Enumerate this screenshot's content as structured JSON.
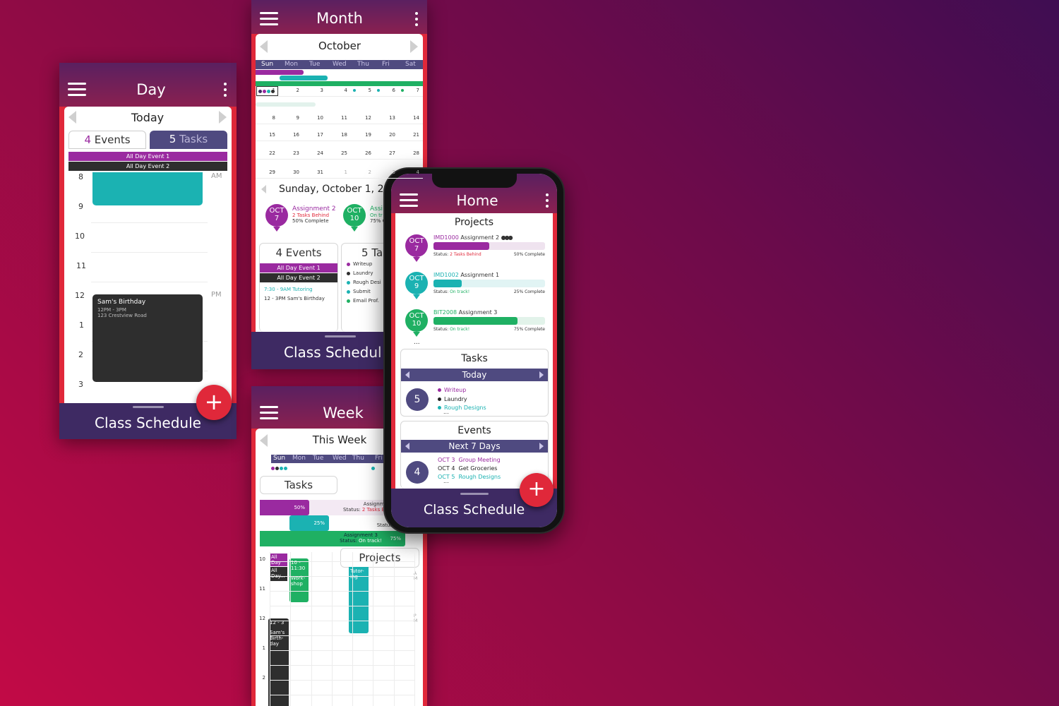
{
  "colors": {
    "purple": "#9a2aa0",
    "teal": "#1bb2b2",
    "green": "#1fb063",
    "navy": "#3e2a63",
    "red": "#e0283a",
    "dark": "#2e2e2e"
  },
  "day": {
    "title": "Day",
    "date_label": "Today",
    "events_tab": {
      "count": "4",
      "label": "Events"
    },
    "tasks_tab": {
      "count": "5",
      "label": "Tasks"
    },
    "all_day": [
      "All Day Event 1",
      "All Day Event 2"
    ],
    "hours": [
      "8",
      "9",
      "10",
      "11",
      "12",
      "1",
      "2",
      "3"
    ],
    "am": "AM",
    "pm": "PM",
    "birthday": {
      "title": "Sam's Birthday",
      "time": "12PM - 3PM",
      "place": "123 Crestview Road"
    },
    "footer": "Class Schedule",
    "fab": "+"
  },
  "month": {
    "title": "Month",
    "month_label": "October",
    "weekdays": [
      "Sun",
      "Mon",
      "Tue",
      "Wed",
      "Thu",
      "Fri",
      "Sat"
    ],
    "weeks": [
      [
        "1",
        "2",
        "3",
        "4",
        "5",
        "6",
        "7"
      ],
      [
        "8",
        "9",
        "10",
        "11",
        "12",
        "13",
        "14"
      ],
      [
        "15",
        "16",
        "17",
        "18",
        "19",
        "20",
        "21"
      ],
      [
        "22",
        "23",
        "24",
        "25",
        "26",
        "27",
        "28"
      ],
      [
        "29",
        "30",
        "31",
        "1",
        "2",
        "3",
        "4"
      ]
    ],
    "selected_date": "Sunday, October 1, 20",
    "projects": [
      {
        "month": "OCT",
        "day": "7",
        "name": "Assignment 2",
        "status": "2 Tasks Behind",
        "progress": "50% Complete"
      },
      {
        "month": "OCT",
        "day": "10",
        "name": "Assi",
        "status": "On tr",
        "progress": "75% C"
      }
    ],
    "events_panel": {
      "count": "4",
      "label": "Events",
      "all_day": [
        "All Day Event 1",
        "All Day Event 2"
      ],
      "item1_time": "7:30 - 9AM",
      "item1_name": "Tutoring",
      "item2_time": "12 - 3PM",
      "item2_name": "Sam's Birthday"
    },
    "tasks_panel": {
      "count": "5",
      "label": "Tas",
      "items": [
        "Writeup",
        "Laundry",
        "Rough Desi",
        "Submit",
        "Email Prof."
      ]
    },
    "footer": "Class Schedul"
  },
  "week": {
    "title": "Week",
    "week_label": "This Week",
    "weekdays": [
      "Sun",
      "Mon",
      "Tue",
      "Wed",
      "Thu",
      "Fri"
    ],
    "tasks_label": "Tasks",
    "projects_label": "Projects",
    "bars": [
      {
        "label": "50%",
        "name": "Assignment",
        "status_prefix": "Status: ",
        "status": "2 Tasks Behi"
      },
      {
        "label": "25%",
        "name": "A",
        "status_prefix": "Status",
        "status": ""
      },
      {
        "label": "75%",
        "name": "Assignment 3",
        "status_prefix": "Status: ",
        "status": "On track!"
      }
    ],
    "hours": [
      "10",
      "11",
      "12",
      "1",
      "2"
    ],
    "blocks": {
      "allday1": "All Day",
      "allday2": "All Day...",
      "workshop_time": "10 - 11:30",
      "workshop": "Work-shop",
      "tutoring": "Tutor-ing",
      "birthday_time": "12 - 3",
      "birthday": "Sam's Birth-day"
    },
    "am": "AM",
    "pm": "PM"
  },
  "home": {
    "title": "Home",
    "projects_label": "Projects",
    "projects": [
      {
        "month": "OCT",
        "day": "7",
        "code": "IMD1000",
        "name": "Assignment 2",
        "status_prefix": "Status: ",
        "status": "2 Tasks Behind",
        "complete": "50% Complete",
        "progress": 0.5
      },
      {
        "month": "OCT",
        "day": "9",
        "code": "IMD1002",
        "name": "Assignment 1",
        "status_prefix": "Status: ",
        "status": "On track!",
        "complete": "25% Complete",
        "progress": 0.25
      },
      {
        "month": "OCT",
        "day": "10",
        "code": "BIT2008",
        "name": "Assignment 3",
        "status_prefix": "Status: ",
        "status": "On track!",
        "complete": "75% Complete",
        "progress": 0.75
      }
    ],
    "more": "...",
    "tasks": {
      "label": "Tasks",
      "nav": "Today",
      "count": "5",
      "items": [
        "Writeup",
        "Laundry",
        "Rough Designs"
      ]
    },
    "events": {
      "label": "Events",
      "nav": "Next 7 Days",
      "count": "4",
      "items": [
        {
          "date": "OCT 3",
          "name": "Group Meeting"
        },
        {
          "date": "OCT 4",
          "name": "Get Groceries"
        },
        {
          "date": "OCT 5",
          "name": "Rough Designs"
        }
      ]
    },
    "footer": "Class Schedule",
    "fab": "+"
  }
}
